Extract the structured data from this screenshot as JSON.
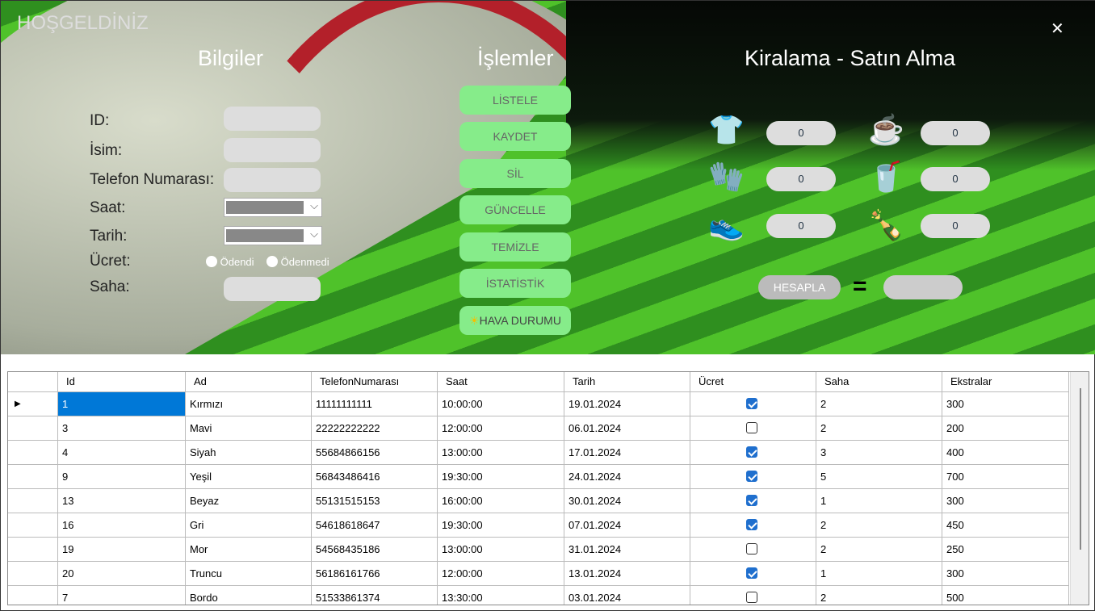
{
  "window": {
    "title": "HOŞGELDİNİZ",
    "close": "✕"
  },
  "sections": {
    "info": "Bilgiler",
    "ops": "İşlemler",
    "rent": "Kiralama - Satın Alma"
  },
  "form": {
    "id": "ID:",
    "name": "İsim:",
    "phone": "Telefon Numarası:",
    "time": "Saat:",
    "date": "Tarih:",
    "fee": "Ücret:",
    "paid": "Ödendi",
    "unpaid": "Ödenmedi",
    "field": "Saha:"
  },
  "buttons": [
    "LİSTELE",
    "KAYDET",
    "SİL",
    "GÜNCELLE",
    "TEMİZLE",
    "İSTATİSTİK",
    "HAVA DURUMU"
  ],
  "weather_icon": "☀",
  "rent": {
    "items": [
      {
        "icon": "jersey-icon",
        "glyph": "👕",
        "value": "0"
      },
      {
        "icon": "tea-icon",
        "glyph": "☕",
        "value": "0"
      },
      {
        "icon": "gloves-icon",
        "glyph": "🧤",
        "value": "0"
      },
      {
        "icon": "water-icon",
        "glyph": "🥤",
        "value": "0"
      },
      {
        "icon": "shoe-icon",
        "glyph": "👟",
        "value": "0"
      },
      {
        "icon": "soda-icon",
        "glyph": "🍾",
        "value": "0"
      }
    ],
    "calc": "HESAPLA",
    "equals": "="
  },
  "table": {
    "columns": [
      "Id",
      "Ad",
      "TelefonNumarası",
      "Saat",
      "Tarih",
      "Ücret",
      "Saha",
      "Ekstralar"
    ],
    "rows": [
      [
        "1",
        "Kırmızı",
        "11111111111",
        "10:00:00",
        "19.01.2024",
        true,
        "2",
        "300"
      ],
      [
        "3",
        "Mavi",
        "22222222222",
        "12:00:00",
        "06.01.2024",
        false,
        "2",
        "200"
      ],
      [
        "4",
        "Siyah",
        "55684866156",
        "13:00:00",
        "17.01.2024",
        true,
        "3",
        "400"
      ],
      [
        "9",
        "Yeşil",
        "56843486416",
        "19:30:00",
        "24.01.2024",
        true,
        "5",
        "700"
      ],
      [
        "13",
        "Beyaz",
        "55131515153",
        "16:00:00",
        "30.01.2024",
        true,
        "1",
        "300"
      ],
      [
        "16",
        "Gri",
        "54618618647",
        "19:30:00",
        "07.01.2024",
        true,
        "2",
        "450"
      ],
      [
        "19",
        "Mor",
        "54568435186",
        "13:00:00",
        "31.01.2024",
        false,
        "2",
        "250"
      ],
      [
        "20",
        "Truncu",
        "56186161766",
        "12:00:00",
        "13.01.2024",
        true,
        "1",
        "300"
      ],
      [
        "7",
        "Bordo",
        "51533861374",
        "13:30:00",
        "03.01.2024",
        false,
        "2",
        "500"
      ]
    ]
  }
}
